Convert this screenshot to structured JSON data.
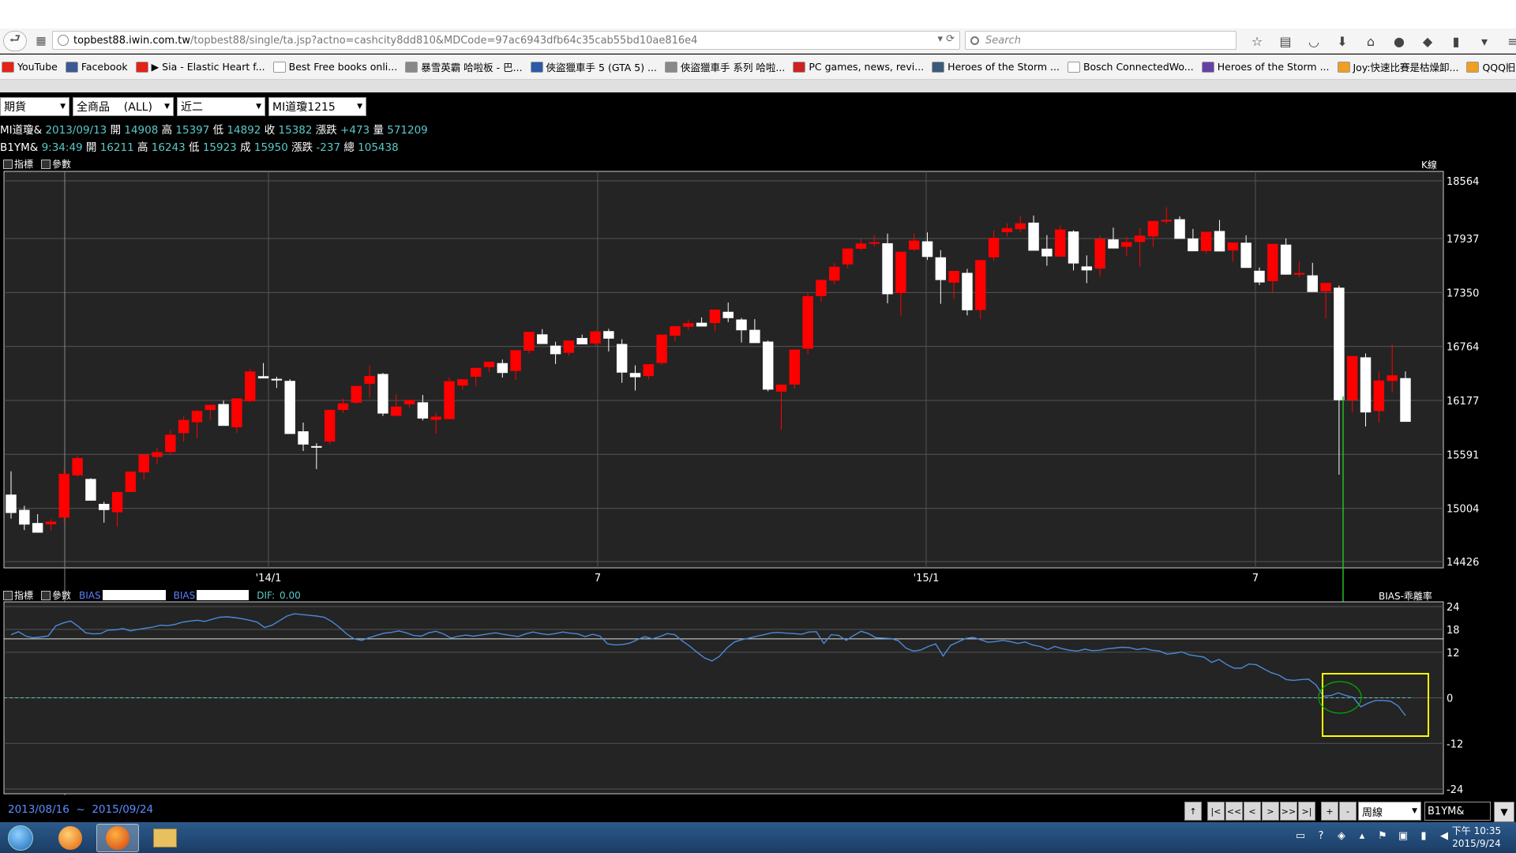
{
  "browser": {
    "url_domain": "topbest88.iwin.com.tw",
    "url_rest": "/topbest88/single/ta.jsp?actno=cashcity8dd810&MDCode=97ac6943dfb64c35cab55bd10ae816e4",
    "search_placeholder": "Search",
    "bookmarks": [
      {
        "label": "YouTube",
        "color": "#e62117"
      },
      {
        "label": "Facebook",
        "color": "#3b5998"
      },
      {
        "label": "▶ Sia - Elastic Heart f...",
        "color": "#e62117"
      },
      {
        "label": "Best Free books onli...",
        "color": "#ffffff"
      },
      {
        "label": "暴雪英霸 哈啦板 - 巴...",
        "color": "#888888"
      },
      {
        "label": "俠盜獵車手 5 (GTA 5) ...",
        "color": "#2a5aa8"
      },
      {
        "label": "俠盜獵車手 系列 哈啦...",
        "color": "#888888"
      },
      {
        "label": "PC games, news, revi...",
        "color": "#d02020"
      },
      {
        "label": "Heroes of the Storm ...",
        "color": "#3a5a7a"
      },
      {
        "label": "Bosch ConnectedWo...",
        "color": "#ffffff"
      },
      {
        "label": "Heroes of the Storm ...",
        "color": "#6441a5"
      },
      {
        "label": "Joy:快速比賽是枯燥卸...",
        "color": "#f0a020"
      },
      {
        "label": "QQQ旧来，恢复稳定...",
        "color": "#f0a020"
      }
    ],
    "bookmarks_more": "»"
  },
  "app": {
    "selects": [
      {
        "value": "期貨",
        "width": 88
      },
      {
        "value": "全商品    (ALL)",
        "width": 128
      },
      {
        "value": "近二",
        "width": 112
      },
      {
        "value": "MI道瓊1215",
        "width": 124
      }
    ],
    "quote1": {
      "name": "MI道瓊&",
      "date": "2013/09/13",
      "open_lbl": "開",
      "open": "14908",
      "high_lbl": "高",
      "high": "15397",
      "low_lbl": "低",
      "low": "14892",
      "close_lbl": "收",
      "close": "15382",
      "chg_lbl": "漲跌",
      "chg": "+473",
      "vol_lbl": "量",
      "vol": "571209"
    },
    "quote2": {
      "name": "B1YM&",
      "time": "9:34:49",
      "open_lbl": "開",
      "open": "16211",
      "high_lbl": "高",
      "high": "16243",
      "low_lbl": "低",
      "low": "15923",
      "close_lbl": "成",
      "close": "15950",
      "chg_lbl": "漲跌",
      "chg": "-237",
      "vol_lbl": "總",
      "vol": "105438"
    },
    "main_panel": {
      "tab1": "指標",
      "tab2": "參數",
      "type_label": "K線"
    },
    "bias_panel": {
      "tab1": "指標",
      "tab2": "參數",
      "bias1_label": "BIAS",
      "bias2_label": "BIAS",
      "dif_label": "DIF:",
      "dif_value": "0.00",
      "type_label": "BIAS-乖離率"
    },
    "date_range_start": "2013/08/16",
    "date_range_sep": "~",
    "date_range_end": "2015/09/24",
    "controls": [
      "↑",
      "|<",
      "<<",
      "<",
      ">",
      ">>",
      ">|",
      "+",
      "-"
    ],
    "period": "周線",
    "symbol": "B1YM&"
  },
  "taskbar": {
    "clock_time": "下午 10:35",
    "clock_date": "2015/9/24"
  },
  "chart_data": [
    {
      "type": "candlestick",
      "title": "",
      "y_ticks": [
        18564,
        17937,
        17350,
        16764,
        16177,
        15591,
        15004,
        14426
      ],
      "ylim": [
        14426,
        18564
      ],
      "x_ticks": [
        "'14/1",
        "7",
        "'15/1",
        "7"
      ],
      "up_color": "#ff0000",
      "down_color": "#ffffff",
      "candles": [
        [
          15154,
          15407,
          14893,
          14954
        ],
        [
          14988,
          15033,
          14768,
          14828
        ],
        [
          14845,
          14941,
          14740,
          14740
        ],
        [
          14831,
          14886,
          14758,
          14860
        ],
        [
          14904,
          15433,
          14856,
          15380
        ],
        [
          15363,
          15579,
          15348,
          15552
        ],
        [
          15324,
          15332,
          15101,
          15088
        ],
        [
          15053,
          15076,
          14849,
          14986
        ],
        [
          14962,
          15192,
          14804,
          15181
        ],
        [
          15182,
          15407,
          15180,
          15404
        ],
        [
          15395,
          15472,
          15319,
          15589
        ],
        [
          15563,
          15666,
          15485,
          15615
        ],
        [
          15617,
          15856,
          15582,
          15805
        ],
        [
          15822,
          16003,
          15731,
          15965
        ],
        [
          15940,
          16074,
          15767,
          16064
        ],
        [
          16073,
          16102,
          15968,
          16130
        ],
        [
          16138,
          16175,
          15951,
          15901
        ],
        [
          15886,
          16184,
          15824,
          16200
        ],
        [
          16169,
          16521,
          16158,
          16492
        ],
        [
          16441,
          16584,
          16424,
          16417
        ],
        [
          16412,
          16434,
          16312,
          16398
        ],
        [
          16390,
          16409,
          15981,
          15813
        ],
        [
          15842,
          15937,
          15628,
          15698
        ],
        [
          15681,
          15712,
          15431,
          15676
        ],
        [
          15731,
          16044,
          15700,
          16075
        ],
        [
          16074,
          16198,
          16042,
          16146
        ],
        [
          16153,
          16302,
          16140,
          16335
        ],
        [
          16358,
          16558,
          16210,
          16444
        ],
        [
          16465,
          16476,
          16009,
          16035
        ],
        [
          16010,
          16243,
          16002,
          16111
        ],
        [
          16135,
          16186,
          16102,
          16181
        ],
        [
          16157,
          16237,
          15960,
          15981
        ],
        [
          15967,
          16045,
          15816,
          16001
        ],
        [
          15974,
          16426,
          15972,
          16387
        ],
        [
          16339,
          16407,
          16296,
          16407
        ],
        [
          16435,
          16504,
          16332,
          16531
        ],
        [
          16539,
          16566,
          16484,
          16598
        ],
        [
          16583,
          16622,
          16426,
          16476
        ],
        [
          16497,
          16589,
          16400,
          16723
        ],
        [
          16718,
          16870,
          16688,
          16923
        ],
        [
          16896,
          16952,
          16825,
          16791
        ],
        [
          16773,
          16815,
          16573,
          16680
        ],
        [
          16695,
          16769,
          16663,
          16828
        ],
        [
          16856,
          16892,
          16790,
          16787
        ],
        [
          16797,
          16939,
          16763,
          16927
        ],
        [
          16931,
          16956,
          16710,
          16849
        ],
        [
          16791,
          16843,
          16369,
          16480
        ],
        [
          16476,
          16558,
          16285,
          16430
        ],
        [
          16442,
          16531,
          16406,
          16571
        ],
        [
          16584,
          16863,
          16560,
          16893
        ],
        [
          16881,
          16991,
          16819,
          16984
        ],
        [
          16978,
          17058,
          16944,
          17017
        ],
        [
          17022,
          17080,
          16982,
          16981
        ],
        [
          17018,
          17079,
          16930,
          17165
        ],
        [
          17141,
          17241,
          17028,
          17072
        ],
        [
          17057,
          17073,
          16807,
          16940
        ],
        [
          16945,
          17061,
          16906,
          16801
        ],
        [
          16817,
          16829,
          16277,
          16295
        ],
        [
          16273,
          16295,
          15855,
          16350
        ],
        [
          16350,
          16729,
          16306,
          16730
        ],
        [
          16740,
          17349,
          16681,
          17311
        ],
        [
          17311,
          17493,
          17252,
          17487
        ],
        [
          17480,
          17669,
          17440,
          17630
        ],
        [
          17656,
          17768,
          17612,
          17829
        ],
        [
          17826,
          17931,
          17811,
          17883
        ],
        [
          17895,
          17973,
          17848,
          17897
        ],
        [
          17886,
          17991,
          17233,
          17332
        ],
        [
          17344,
          17360,
          17097,
          17794
        ],
        [
          17817,
          17992,
          17800,
          17915
        ],
        [
          17907,
          18004,
          17705,
          17737
        ],
        [
          17733,
          17811,
          17228,
          17486
        ],
        [
          17458,
          17567,
          17278,
          17585
        ],
        [
          17564,
          17607,
          17102,
          17158
        ],
        [
          17160,
          17336,
          17063,
          17703
        ],
        [
          17733,
          18026,
          17695,
          17945
        ],
        [
          18006,
          18103,
          17959,
          18050
        ],
        [
          18039,
          18183,
          18006,
          18103
        ],
        [
          18110,
          18187,
          17857,
          17805
        ],
        [
          17827,
          17974,
          17641,
          17743
        ],
        [
          17740,
          18080,
          17738,
          18035
        ],
        [
          18014,
          18027,
          17591,
          17666
        ],
        [
          17634,
          17754,
          17453,
          17591
        ],
        [
          17610,
          17970,
          17524,
          17933
        ],
        [
          17928,
          18056,
          17863,
          17829
        ],
        [
          17847,
          17957,
          17747,
          17899
        ],
        [
          17900,
          18051,
          17630,
          17969
        ],
        [
          17960,
          18108,
          17847,
          18128
        ],
        [
          18136,
          18278,
          18095,
          18140
        ],
        [
          18147,
          18179,
          17972,
          17934
        ],
        [
          17938,
          18041,
          17852,
          17799
        ],
        [
          17801,
          17971,
          17779,
          18011
        ],
        [
          18019,
          18138,
          17825,
          17797
        ],
        [
          17808,
          17872,
          17685,
          17894
        ],
        [
          17892,
          17972,
          17733,
          17618
        ],
        [
          17587,
          17623,
          17431,
          17460
        ],
        [
          17474,
          17493,
          17350,
          17879
        ],
        [
          17871,
          17938,
          17544,
          17545
        ],
        [
          17550,
          17691,
          17516,
          17562
        ],
        [
          17537,
          17673,
          17386,
          17356
        ],
        [
          17364,
          17444,
          17067,
          17455
        ],
        [
          17403,
          17427,
          15370,
          16180
        ],
        [
          16180,
          16578,
          16050,
          16660
        ],
        [
          16646,
          16689,
          15894,
          16047
        ],
        [
          16062,
          16495,
          15937,
          16394
        ],
        [
          16389,
          16784,
          16265,
          16451
        ],
        [
          16420,
          16493,
          15968,
          15945
        ]
      ]
    },
    {
      "type": "line",
      "title": "",
      "series_label": "BIAS",
      "y_ticks": [
        24,
        18,
        12,
        0,
        -12,
        -24
      ],
      "ylim": [
        -24,
        24
      ],
      "values": [
        16.6,
        17.4,
        16.2,
        15.8,
        16.0,
        16.3,
        18.9,
        19.7,
        20.2,
        18.8,
        17.1,
        16.8,
        16.9,
        17.8,
        17.9,
        18.2,
        17.6,
        18.0,
        18.3,
        18.6,
        19.1,
        19.0,
        19.3,
        19.9,
        20.2,
        20.4,
        20.1,
        20.7,
        21.2,
        21.3,
        21.1,
        20.8,
        20.4,
        19.9,
        18.5,
        19.1,
        20.3,
        21.5,
        22.1,
        21.9,
        21.7,
        21.5,
        21.2,
        20.1,
        18.6,
        16.8,
        15.5,
        15.1,
        15.8,
        16.4,
        17.0,
        17.2,
        17.6,
        17.1,
        16.4,
        16.2,
        17.1,
        17.5,
        16.8,
        15.7,
        16.2,
        16.5,
        16.2,
        16.5,
        16.8,
        17.1,
        16.7,
        16.4,
        16.1,
        16.8,
        17.3,
        16.9,
        16.6,
        16.9,
        17.3,
        17.0,
        16.8,
        16.1,
        16.7,
        16.2,
        14.2,
        13.9,
        14.0,
        14.4,
        15.3,
        16.1,
        15.5,
        16.1,
        16.9,
        16.6,
        15.0,
        13.6,
        12.0,
        10.5,
        9.7,
        10.9,
        13.1,
        14.7,
        15.3,
        15.7,
        16.2,
        16.6,
        17.1,
        17.2,
        17.0,
        16.9,
        16.7,
        17.3,
        17.4,
        14.3,
        16.6,
        16.4,
        15.1,
        16.4,
        17.5,
        16.9,
        15.8,
        15.7,
        15.6,
        15.0,
        13.1,
        12.3,
        12.6,
        13.5,
        14.2,
        11.0,
        13.8,
        14.7,
        15.6,
        15.9,
        15.3,
        14.6,
        14.8,
        15.1,
        14.8,
        14.3,
        14.7,
        13.9,
        13.5,
        12.7,
        13.5,
        12.9,
        12.5,
        12.3,
        12.8,
        12.4,
        12.5,
        12.9,
        13.1,
        13.3,
        13.2,
        12.7,
        13.0,
        12.5,
        12.3,
        11.5,
        11.7,
        12.1,
        11.3,
        11.0,
        10.7,
        9.3,
        10.1,
        8.8,
        7.8,
        7.8,
        8.9,
        8.7,
        7.6,
        6.6,
        6.0,
        4.8,
        4.6,
        4.8,
        4.9,
        3.4,
        0.4,
        0.6,
        1.3,
        0.6,
        0.1,
        -2.4,
        -1.4,
        -0.7,
        -0.7,
        -0.9,
        -2.1,
        -4.7
      ],
      "highlight_color": "#ffff00",
      "circle_color": "#00b000"
    }
  ]
}
